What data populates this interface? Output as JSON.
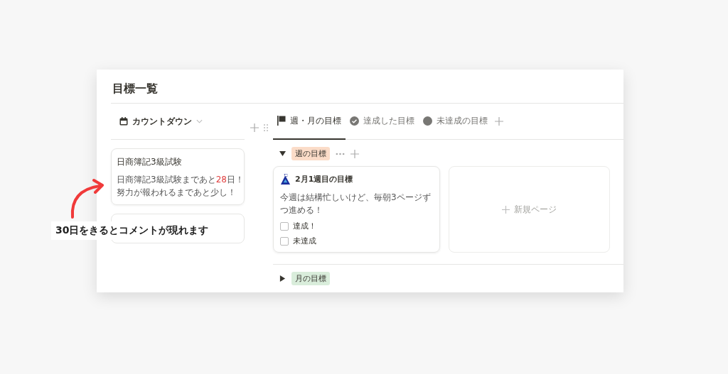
{
  "page": {
    "title": "目標一覧"
  },
  "left_view": {
    "label": "カウントダウン",
    "cards": [
      {
        "title": "日商簿記3級試験",
        "comment_lines": [
          [
            {
              "text": "日商簿記3級試験まであと",
              "highlight": false
            },
            {
              "text": "28",
              "highlight": true
            },
            {
              "text": "日！",
              "highlight": false
            }
          ],
          [
            {
              "text": "努力が報われるまであと少し！",
              "highlight": false
            }
          ]
        ]
      }
    ],
    "new_card": {
      "kind": "covered"
    }
  },
  "tabs": [
    {
      "label": "週・月の目標",
      "selected": true
    },
    {
      "label": "達成した目標",
      "selected": false
    },
    {
      "label": "未達成の目標",
      "selected": false
    }
  ],
  "groups": [
    {
      "label": "週の目標",
      "color": "#fbdcc8",
      "expanded": true,
      "cards": [
        {
          "title": "2月1週目の目標",
          "text": "今週は結構忙しいけど、毎朝3ページずつ進める！",
          "checks": [
            {
              "label": "達成！",
              "checked": false
            },
            {
              "label": "未達成",
              "checked": false
            }
          ]
        }
      ],
      "new_page": "新規ページ"
    },
    {
      "label": "月の目標",
      "color": "#d9eddb",
      "expanded": false
    }
  ],
  "callout": {
    "text": "30日をきるとコメントが現れます"
  }
}
